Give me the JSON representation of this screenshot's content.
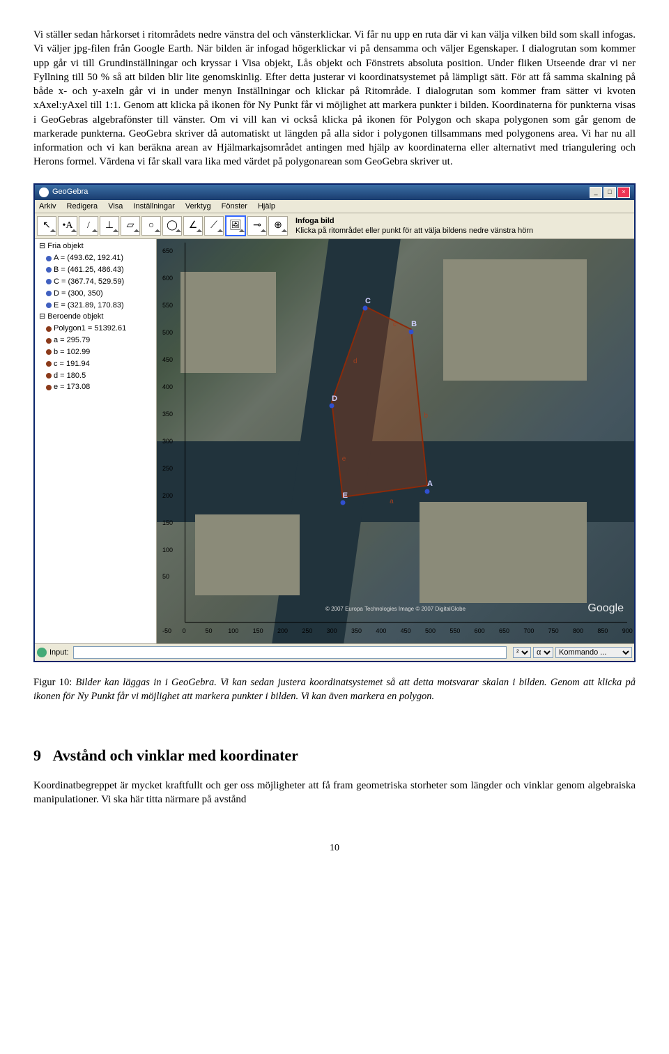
{
  "paragraph1": "Vi ställer sedan hårkorset i ritområdets nedre vänstra del och vänsterklickar. Vi får nu upp en ruta där vi kan välja vilken bild som skall infogas. Vi väljer jpg-filen från Google Earth. När bilden är infogad högerklickar vi på densamma och väljer Egenskaper. I dialogrutan som kommer upp går vi till Grundinställningar och kryssar i Visa objekt, Lås objekt och Fönstrets absoluta position. Under fliken Utseende drar vi ner Fyllning till 50 % så att bilden blir lite genomskinlig. Efter detta justerar vi koordinatsystemet på lämpligt sätt. För att få samma skalning på både x- och y-axeln går vi in under menyn Inställningar och klickar på Ritområde. I dialogrutan som kommer fram sätter vi kvoten xAxel:yAxel till 1:1. Genom att klicka på ikonen för Ny Punkt får vi möjlighet att markera punkter i bilden. Koordinaterna för punkterna visas i GeoGebras algebrafönster till vänster. Om vi vill kan vi också klicka på ikonen för Polygon och skapa polygonen som går genom de markerade punkterna. GeoGebra skriver då automatiskt ut längden på alla sidor i polygonen tillsammans med polygonens area. Vi har nu all information och vi kan beräkna arean av Hjälmarkajsområdet antingen med hjälp av koordinaterna eller alternativt med triangulering och Herons formel. Värdena vi får skall vara lika med värdet på polygonarean som GeoGebra skriver ut.",
  "app": {
    "title": "GeoGebra",
    "menu": [
      "Arkiv",
      "Redigera",
      "Visa",
      "Inställningar",
      "Verktyg",
      "Fönster",
      "Hjälp"
    ],
    "tool_title": "Infoga bild",
    "tool_hint": "Klicka på ritområdet eller punkt för att välja bildens nedre vänstra hörn",
    "input_label": "Input:",
    "command_placeholder": "Kommando ...",
    "greek": "α",
    "sup": "²"
  },
  "algebra": {
    "free_header": "Fria objekt",
    "free": [
      "A = (493.62, 192.41)",
      "B = (461.25, 486.43)",
      "C = (367.74, 529.59)",
      "D = (300, 350)",
      "E = (321.89, 170.83)"
    ],
    "dep_header": "Beroende objekt",
    "dep": [
      {
        "t": "Polygon1 = 51392.61",
        "c": "brown"
      },
      {
        "t": "a = 295.79",
        "c": "brown"
      },
      {
        "t": "b = 102.99",
        "c": "brown"
      },
      {
        "t": "c = 191.94",
        "c": "brown"
      },
      {
        "t": "d = 180.5",
        "c": "brown"
      },
      {
        "t": "e = 173.08",
        "c": "brown"
      }
    ]
  },
  "chart_data": {
    "type": "scatter",
    "title": "",
    "xlabel": "",
    "ylabel": "",
    "xlim": [
      0,
      900
    ],
    "ylim": [
      -50,
      650
    ],
    "x_ticks": [
      0,
      50,
      100,
      150,
      200,
      250,
      300,
      350,
      400,
      450,
      500,
      550,
      600,
      650,
      700,
      750,
      800,
      850,
      900
    ],
    "y_ticks": [
      -50,
      50,
      100,
      150,
      200,
      250,
      300,
      350,
      400,
      450,
      500,
      550,
      600,
      650
    ],
    "points": {
      "A": [
        493.62,
        192.41
      ],
      "B": [
        461.25,
        486.43
      ],
      "C": [
        367.74,
        529.59
      ],
      "D": [
        300,
        350
      ],
      "E": [
        321.89,
        170.83
      ]
    },
    "polygon_order": [
      "A",
      "B",
      "C",
      "D",
      "E"
    ],
    "segments": {
      "a": 295.79,
      "b": 102.99,
      "c": 191.94,
      "d": 180.5,
      "e": 173.08
    },
    "polygon_area": 51392.61
  },
  "attribution": "© 2007 Europa Technologies\nImage © 2007 DigitalGlobe",
  "google": "Google",
  "caption_label": "Figur 10:",
  "caption_text": "Bilder kan läggas in i GeoGebra. Vi kan sedan justera koordinatsystemet så att detta motsvarar skalan i bilden. Genom att klicka på ikonen för Ny Punkt får vi möjlighet att markera punkter i bilden. Vi kan även markera en polygon.",
  "section_num": "9",
  "section_title": "Avstånd och vinklar med koordinater",
  "paragraph2": "Koordinatbegreppet är mycket kraftfullt och ger oss möjligheter att få fram geometriska storheter som längder och vinklar genom algebraiska manipulationer. Vi ska här titta närmare på avstånd",
  "page_number": "10"
}
